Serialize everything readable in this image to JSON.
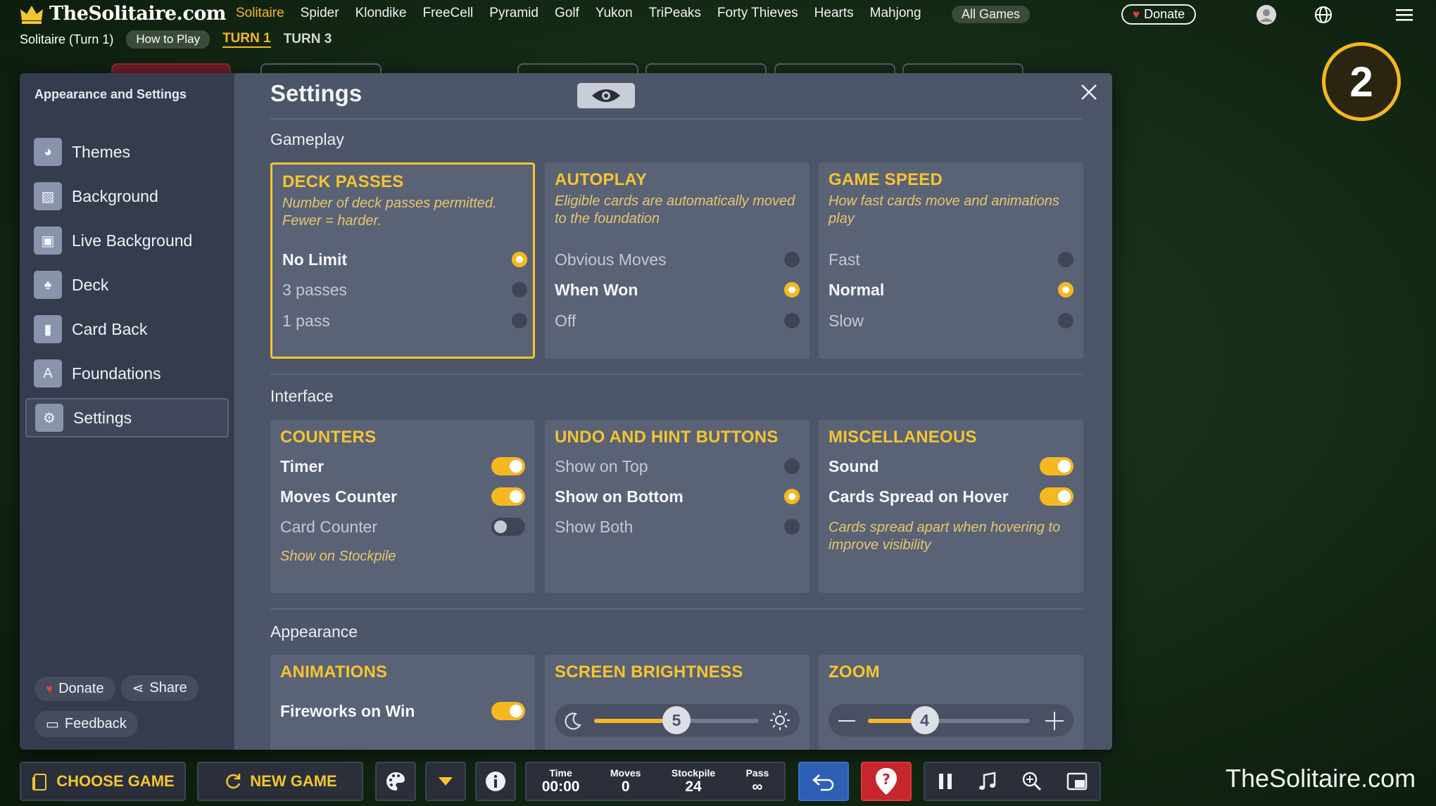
{
  "site": {
    "logo_text": "TheSolitaire.com",
    "watermark": "TheSolitaire.com"
  },
  "nav": {
    "items": [
      "Solitaire",
      "Spider",
      "Klondike",
      "FreeCell",
      "Pyramid",
      "Golf",
      "Yukon",
      "TriPeaks",
      "Forty Thieves",
      "Hearts",
      "Mahjong"
    ],
    "active": "Solitaire",
    "all_games": "All Games",
    "donate": "Donate"
  },
  "subbar": {
    "game_name": "Solitaire (Turn 1)",
    "how_to_play": "How to Play",
    "turn1": "TURN 1",
    "turn3": "TURN 3"
  },
  "turn_badge": "2",
  "dialog": {
    "sidebar": {
      "title": "Appearance and Settings",
      "items": [
        {
          "label": "Themes",
          "icon": "palette-icon"
        },
        {
          "label": "Background",
          "icon": "image-icon"
        },
        {
          "label": "Live Background",
          "icon": "video-icon"
        },
        {
          "label": "Deck",
          "icon": "spade-icon"
        },
        {
          "label": "Card Back",
          "icon": "card-back-icon"
        },
        {
          "label": "Foundations",
          "icon": "foundation-icon"
        },
        {
          "label": "Settings",
          "icon": "gear-icon"
        }
      ],
      "active": "Settings",
      "donate": "Donate",
      "share": "Share",
      "feedback": "Feedback"
    },
    "title": "Settings",
    "sections": {
      "gameplay": "Gameplay",
      "interface": "Interface",
      "appearance": "Appearance"
    },
    "deck_passes": {
      "title": "DECK PASSES",
      "desc": "Number of deck passes permitted. Fewer = harder.",
      "options": [
        "No Limit",
        "3 passes",
        "1 pass"
      ],
      "selected": 0
    },
    "autoplay": {
      "title": "AUTOPLAY",
      "desc": "Eligible cards are automatically moved to the foundation",
      "options": [
        "Obvious Moves",
        "When Won",
        "Off"
      ],
      "selected": 1
    },
    "game_speed": {
      "title": "GAME SPEED",
      "desc": "How fast cards move and animations play",
      "options": [
        "Fast",
        "Normal",
        "Slow"
      ],
      "selected": 1
    },
    "counters": {
      "title": "COUNTERS",
      "timer": "Timer",
      "timer_on": true,
      "moves": "Moves Counter",
      "moves_on": true,
      "card_counter": "Card Counter",
      "card_counter_on": false,
      "note": "Show on Stockpile"
    },
    "undo_hint": {
      "title": "UNDO AND HINT BUTTONS",
      "options": [
        "Show on Top",
        "Show on Bottom",
        "Show Both"
      ],
      "selected": 1
    },
    "misc": {
      "title": "MISCELLANEOUS",
      "sound": "Sound",
      "sound_on": true,
      "spread": "Cards Spread on Hover",
      "spread_on": true,
      "note": "Cards spread apart when hovering to improve visibility"
    },
    "animations": {
      "title": "ANIMATIONS",
      "fireworks": "Fireworks on Win",
      "fireworks_on": true
    },
    "brightness": {
      "title": "SCREEN BRIGHTNESS",
      "value": "5",
      "level": 0.5
    },
    "zoom": {
      "title": "ZOOM",
      "value": "4",
      "level": 0.35
    }
  },
  "bottom": {
    "choose_game": "CHOOSE GAME",
    "new_game": "NEW GAME",
    "time_label": "Time",
    "time": "00:00",
    "moves_label": "Moves",
    "moves": "0",
    "stockpile_label": "Stockpile",
    "stockpile": "24",
    "pass_label": "Pass",
    "pass": "∞"
  },
  "colors": {
    "accent": "#f5b820",
    "panel": "#4d5568",
    "sidebar": "#353c4d"
  }
}
